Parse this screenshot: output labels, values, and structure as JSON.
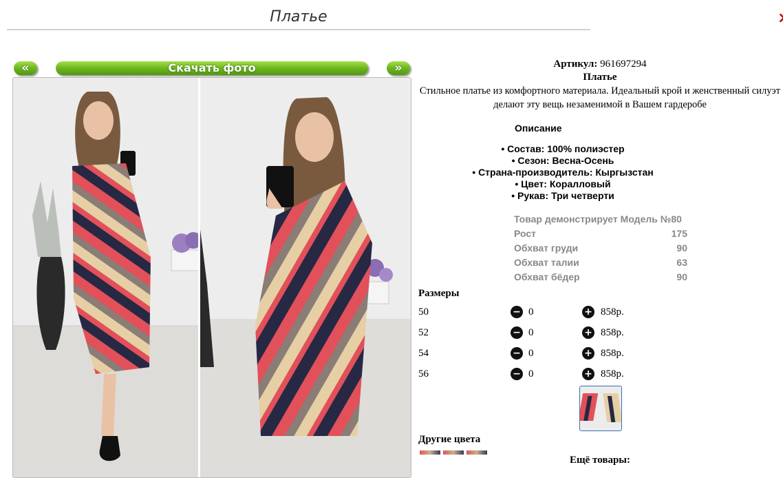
{
  "page": {
    "title": "Платье",
    "close_glyph": "×"
  },
  "toolbar": {
    "prev_label": "«",
    "download_label": "Скачать фото",
    "next_label": "»"
  },
  "product": {
    "sku_label": "Артикул:",
    "sku_value": "961697294",
    "name": "Платье",
    "description": "Стильное платье из комфортного материала. Идеальный крой и женственный силуэт делают эту вещь незаменимой в Вашем гардеробе",
    "description_heading": "Описание",
    "features": [
      "• Состав: 100% полиэстер",
      "• Сезон: Весна-Осень",
      "• Страна-производитель: Кыргызстан",
      "• Цвет: Коралловый",
      "• Рукав: Три четверти"
    ]
  },
  "model": {
    "rows": [
      {
        "label": "Товар демонстрирует Модель №80",
        "value": ""
      },
      {
        "label": "Рост",
        "value": "175"
      },
      {
        "label": "Обхват груди",
        "value": "90"
      },
      {
        "label": "Обхват талии",
        "value": "63"
      },
      {
        "label": "Обхват бёдер",
        "value": "90"
      }
    ]
  },
  "sizes": {
    "heading": "Размеры",
    "minus_icon": "−",
    "plus_icon": "+",
    "rows": [
      {
        "size": "50",
        "qty": "0",
        "price": "858р."
      },
      {
        "size": "52",
        "qty": "0",
        "price": "858р."
      },
      {
        "size": "54",
        "qty": "0",
        "price": "858р."
      },
      {
        "size": "56",
        "qty": "0",
        "price": "858р."
      }
    ]
  },
  "other": {
    "colors_heading": "Другие цвета",
    "more_heading": "Ещё товары:"
  },
  "colors": {
    "accent_green": "#6eb51f",
    "coral": "#e2505a",
    "navy": "#262844",
    "beige": "#e6cfa5",
    "taupe": "#8a7d76"
  }
}
